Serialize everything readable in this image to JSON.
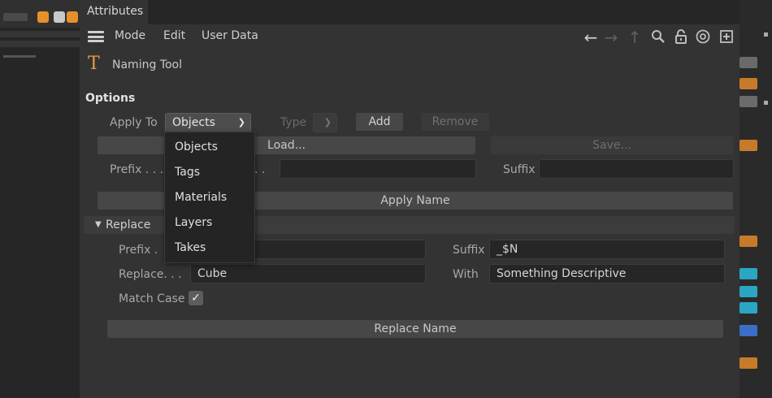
{
  "attributes": {
    "tab_title": "Attributes",
    "menu": [
      "Mode",
      "Edit",
      "User Data"
    ],
    "nav_icons": [
      "back-arrow-icon",
      "forward-arrow-icon",
      "up-arrow-icon",
      "search-icon",
      "lock-icon",
      "target-icon",
      "new-panel-icon"
    ]
  },
  "object": {
    "icon": "T",
    "name": "Naming Tool"
  },
  "options": {
    "title": "Options",
    "apply_to_label": "Apply To",
    "apply_to_value": "Objects",
    "type_label": "Type",
    "add_label": "Add",
    "remove_label": "Remove",
    "load_label": "Load...",
    "save_label": "Save...",
    "prefix_label": "Prefix . . .",
    "prefix_dots": ". .",
    "suffix_label": "Suffix",
    "apply_name_label": "Apply Name"
  },
  "dropdown": {
    "items": [
      "Objects",
      "Tags",
      "Materials",
      "Layers",
      "Takes"
    ]
  },
  "replace": {
    "title": "Replace",
    "prefix_label": "Prefix .",
    "suffix_label": "Suffix",
    "suffix_value": "_$N",
    "replace_label": "Replace. . .",
    "replace_value": "Cube",
    "with_label": "With",
    "with_value": "Something Descriptive",
    "match_case_label": "Match Case",
    "match_case_checked": true,
    "replace_name_label": "Replace Name"
  },
  "colors": {
    "panel": "#333333",
    "field": "#262626",
    "accent_icon": "#e0a040"
  }
}
